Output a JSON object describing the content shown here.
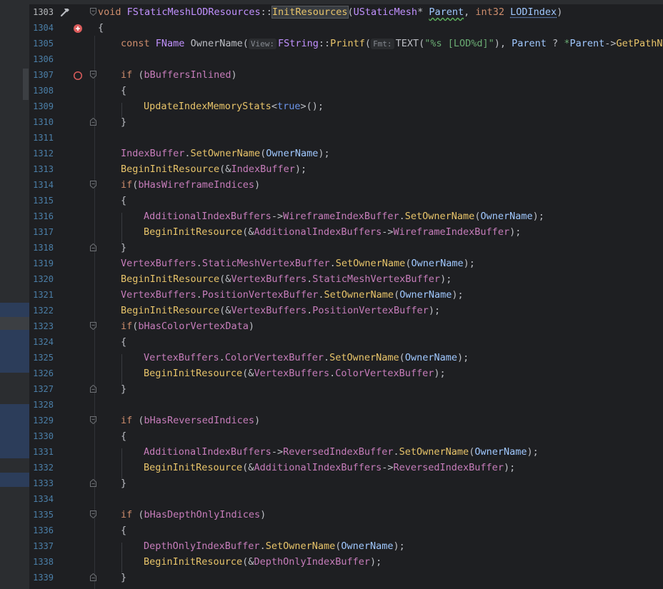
{
  "editor": {
    "lines": [
      {
        "num": "1303",
        "current": true,
        "gutter": "hammer-icon",
        "fold": "open",
        "indent": 0,
        "tokens": [
          [
            "t-kw",
            "void "
          ],
          [
            "t-cls",
            "FStaticMeshLODResources"
          ],
          [
            "t-punc",
            "::"
          ],
          [
            "t-call sel",
            "InitResources"
          ],
          [
            "t-punc",
            "("
          ],
          [
            "t-cls",
            "UStaticMesh"
          ],
          [
            "t-punc",
            "* "
          ],
          [
            "t-par squig",
            "Parent"
          ],
          [
            "t-punc",
            ", "
          ],
          [
            "t-kw",
            "int32 "
          ],
          [
            "t-par squig2",
            "LODIndex"
          ],
          [
            "t-punc",
            ")"
          ]
        ]
      },
      {
        "num": "1304",
        "gutter": "breakpoint-add-icon",
        "fold": "",
        "indent": 0,
        "tokens": [
          [
            "t-punc",
            "{"
          ]
        ]
      },
      {
        "num": "1305",
        "gutter": "",
        "fold": "",
        "indent": 1,
        "tokens": [
          [
            "t-kw",
            "const "
          ],
          [
            "t-cls",
            "FName "
          ],
          [
            "t-var",
            "OwnerName("
          ],
          [
            "hint",
            "View:"
          ],
          [
            "t-cls",
            "FString"
          ],
          [
            "t-punc",
            "::"
          ],
          [
            "t-call",
            "Printf"
          ],
          [
            "t-punc",
            "("
          ],
          [
            "hint",
            "Fmt:"
          ],
          [
            "t-mac",
            "TEXT("
          ],
          [
            "t-str",
            "\"%s [LOD%d]\""
          ],
          [
            "t-punc",
            "), "
          ],
          [
            "t-par",
            "Parent"
          ],
          [
            "t-punc",
            " ? "
          ],
          [
            "t-str",
            "*"
          ],
          [
            "t-par",
            "Parent"
          ],
          [
            "t-punc",
            "->"
          ],
          [
            "t-call",
            "GetPathName"
          ]
        ]
      },
      {
        "num": "1306",
        "gutter": "",
        "fold": "",
        "indent": 0,
        "tokens": []
      },
      {
        "num": "1307",
        "gutter": "breakpoint-icon",
        "fold": "open",
        "indent": 1,
        "tokens": [
          [
            "t-kw",
            "if "
          ],
          [
            "t-punc",
            "("
          ],
          [
            "t-mem",
            "bBuffersInlined"
          ],
          [
            "t-punc",
            ")"
          ]
        ]
      },
      {
        "num": "1308",
        "gutter": "",
        "fold": "",
        "indent": 1,
        "tokens": [
          [
            "t-punc",
            "{"
          ]
        ]
      },
      {
        "num": "1309",
        "gutter": "",
        "fold": "",
        "indent": 2,
        "tokens": [
          [
            "t-call",
            "UpdateIndexMemoryStats"
          ],
          [
            "t-punc",
            "<"
          ],
          [
            "t-kw2",
            "true"
          ],
          [
            "t-punc",
            ">();"
          ]
        ]
      },
      {
        "num": "1310",
        "gutter": "",
        "fold": "close",
        "indent": 1,
        "tokens": [
          [
            "t-punc",
            "}"
          ]
        ]
      },
      {
        "num": "1311",
        "gutter": "",
        "fold": "",
        "indent": 0,
        "tokens": []
      },
      {
        "num": "1312",
        "gutter": "",
        "fold": "",
        "indent": 1,
        "tokens": [
          [
            "t-mem",
            "IndexBuffer"
          ],
          [
            "t-punc",
            "."
          ],
          [
            "t-call",
            "SetOwnerName"
          ],
          [
            "t-punc",
            "("
          ],
          [
            "t-par",
            "OwnerName"
          ],
          [
            "t-punc",
            ");"
          ]
        ]
      },
      {
        "num": "1313",
        "gutter": "",
        "fold": "",
        "indent": 1,
        "tokens": [
          [
            "t-call",
            "BeginInitResource"
          ],
          [
            "t-punc",
            "(&"
          ],
          [
            "t-mem",
            "IndexBuffer"
          ],
          [
            "t-punc",
            ");"
          ]
        ]
      },
      {
        "num": "1314",
        "gutter": "",
        "fold": "open",
        "indent": 1,
        "tokens": [
          [
            "t-kw",
            "if"
          ],
          [
            "t-punc",
            "("
          ],
          [
            "t-mem",
            "bHasWireframeIndices"
          ],
          [
            "t-punc",
            ")"
          ]
        ]
      },
      {
        "num": "1315",
        "gutter": "",
        "fold": "",
        "indent": 1,
        "tokens": [
          [
            "t-punc",
            "{"
          ]
        ]
      },
      {
        "num": "1316",
        "gutter": "",
        "fold": "",
        "indent": 2,
        "tokens": [
          [
            "t-mem",
            "AdditionalIndexBuffers"
          ],
          [
            "t-punc",
            "->"
          ],
          [
            "t-mem",
            "WireframeIndexBuffer"
          ],
          [
            "t-punc",
            "."
          ],
          [
            "t-call",
            "SetOwnerName"
          ],
          [
            "t-punc",
            "("
          ],
          [
            "t-par",
            "OwnerName"
          ],
          [
            "t-punc",
            ");"
          ]
        ]
      },
      {
        "num": "1317",
        "gutter": "",
        "fold": "",
        "indent": 2,
        "tokens": [
          [
            "t-call",
            "BeginInitResource"
          ],
          [
            "t-punc",
            "(&"
          ],
          [
            "t-mem",
            "AdditionalIndexBuffers"
          ],
          [
            "t-punc",
            "->"
          ],
          [
            "t-mem",
            "WireframeIndexBuffer"
          ],
          [
            "t-punc",
            ");"
          ]
        ]
      },
      {
        "num": "1318",
        "gutter": "",
        "fold": "close",
        "indent": 1,
        "tokens": [
          [
            "t-punc",
            "}"
          ]
        ]
      },
      {
        "num": "1319",
        "gutter": "",
        "fold": "",
        "indent": 1,
        "tokens": [
          [
            "t-mem",
            "VertexBuffers"
          ],
          [
            "t-punc",
            "."
          ],
          [
            "t-mem",
            "StaticMeshVertexBuffer"
          ],
          [
            "t-punc",
            "."
          ],
          [
            "t-call",
            "SetOwnerName"
          ],
          [
            "t-punc",
            "("
          ],
          [
            "t-par",
            "OwnerName"
          ],
          [
            "t-punc",
            ");"
          ]
        ]
      },
      {
        "num": "1320",
        "gutter": "",
        "fold": "",
        "indent": 1,
        "tokens": [
          [
            "t-call",
            "BeginInitResource"
          ],
          [
            "t-punc",
            "(&"
          ],
          [
            "t-mem",
            "VertexBuffers"
          ],
          [
            "t-punc",
            "."
          ],
          [
            "t-mem",
            "StaticMeshVertexBuffer"
          ],
          [
            "t-punc",
            ");"
          ]
        ]
      },
      {
        "num": "1321",
        "gutter": "",
        "fold": "",
        "indent": 1,
        "tokens": [
          [
            "t-mem",
            "VertexBuffers"
          ],
          [
            "t-punc",
            "."
          ],
          [
            "t-mem",
            "PositionVertexBuffer"
          ],
          [
            "t-punc",
            "."
          ],
          [
            "t-call",
            "SetOwnerName"
          ],
          [
            "t-punc",
            "("
          ],
          [
            "t-par",
            "OwnerName"
          ],
          [
            "t-punc",
            ");"
          ]
        ]
      },
      {
        "num": "1322",
        "gutter": "",
        "fold": "",
        "indent": 1,
        "tokens": [
          [
            "t-call",
            "BeginInitResource"
          ],
          [
            "t-punc",
            "(&"
          ],
          [
            "t-mem",
            "VertexBuffers"
          ],
          [
            "t-punc",
            "."
          ],
          [
            "t-mem",
            "PositionVertexBuffer"
          ],
          [
            "t-punc",
            ");"
          ]
        ]
      },
      {
        "num": "1323",
        "gutter": "",
        "fold": "open",
        "indent": 1,
        "tokens": [
          [
            "t-kw",
            "if"
          ],
          [
            "t-punc",
            "("
          ],
          [
            "t-mem",
            "bHasColorVertexData"
          ],
          [
            "t-punc",
            ")"
          ]
        ]
      },
      {
        "num": "1324",
        "gutter": "",
        "fold": "",
        "indent": 1,
        "tokens": [
          [
            "t-punc",
            "{"
          ]
        ]
      },
      {
        "num": "1325",
        "gutter": "",
        "fold": "",
        "indent": 2,
        "tokens": [
          [
            "t-mem",
            "VertexBuffers"
          ],
          [
            "t-punc",
            "."
          ],
          [
            "t-mem",
            "ColorVertexBuffer"
          ],
          [
            "t-punc",
            "."
          ],
          [
            "t-call",
            "SetOwnerName"
          ],
          [
            "t-punc",
            "("
          ],
          [
            "t-par",
            "OwnerName"
          ],
          [
            "t-punc",
            ");"
          ]
        ]
      },
      {
        "num": "1326",
        "gutter": "",
        "fold": "",
        "indent": 2,
        "tokens": [
          [
            "t-call",
            "BeginInitResource"
          ],
          [
            "t-punc",
            "(&"
          ],
          [
            "t-mem",
            "VertexBuffers"
          ],
          [
            "t-punc",
            "."
          ],
          [
            "t-mem",
            "ColorVertexBuffer"
          ],
          [
            "t-punc",
            ");"
          ]
        ]
      },
      {
        "num": "1327",
        "gutter": "",
        "fold": "close",
        "indent": 1,
        "tokens": [
          [
            "t-punc",
            "}"
          ]
        ]
      },
      {
        "num": "1328",
        "gutter": "",
        "fold": "",
        "indent": 0,
        "tokens": []
      },
      {
        "num": "1329",
        "gutter": "",
        "fold": "open",
        "indent": 1,
        "tokens": [
          [
            "t-kw",
            "if "
          ],
          [
            "t-punc",
            "("
          ],
          [
            "t-mem",
            "bHasReversedIndices"
          ],
          [
            "t-punc",
            ")"
          ]
        ]
      },
      {
        "num": "1330",
        "gutter": "",
        "fold": "",
        "indent": 1,
        "tokens": [
          [
            "t-punc",
            "{"
          ]
        ]
      },
      {
        "num": "1331",
        "gutter": "",
        "fold": "",
        "indent": 2,
        "tokens": [
          [
            "t-mem",
            "AdditionalIndexBuffers"
          ],
          [
            "t-punc",
            "->"
          ],
          [
            "t-mem",
            "ReversedIndexBuffer"
          ],
          [
            "t-punc",
            "."
          ],
          [
            "t-call",
            "SetOwnerName"
          ],
          [
            "t-punc",
            "("
          ],
          [
            "t-par",
            "OwnerName"
          ],
          [
            "t-punc",
            ");"
          ]
        ]
      },
      {
        "num": "1332",
        "gutter": "",
        "fold": "",
        "indent": 2,
        "tokens": [
          [
            "t-call",
            "BeginInitResource"
          ],
          [
            "t-punc",
            "(&"
          ],
          [
            "t-mem",
            "AdditionalIndexBuffers"
          ],
          [
            "t-punc",
            "->"
          ],
          [
            "t-mem",
            "ReversedIndexBuffer"
          ],
          [
            "t-punc",
            ");"
          ]
        ]
      },
      {
        "num": "1333",
        "gutter": "",
        "fold": "close",
        "indent": 1,
        "tokens": [
          [
            "t-punc",
            "}"
          ]
        ]
      },
      {
        "num": "1334",
        "gutter": "",
        "fold": "",
        "indent": 0,
        "tokens": []
      },
      {
        "num": "1335",
        "gutter": "",
        "fold": "open",
        "indent": 1,
        "tokens": [
          [
            "t-kw",
            "if "
          ],
          [
            "t-punc",
            "("
          ],
          [
            "t-mem",
            "bHasDepthOnlyIndices"
          ],
          [
            "t-punc",
            ")"
          ]
        ]
      },
      {
        "num": "1336",
        "gutter": "",
        "fold": "",
        "indent": 1,
        "tokens": [
          [
            "t-punc",
            "{"
          ]
        ]
      },
      {
        "num": "1337",
        "gutter": "",
        "fold": "",
        "indent": 2,
        "tokens": [
          [
            "t-mem",
            "DepthOnlyIndexBuffer"
          ],
          [
            "t-punc",
            "."
          ],
          [
            "t-call",
            "SetOwnerName"
          ],
          [
            "t-punc",
            "("
          ],
          [
            "t-par",
            "OwnerName"
          ],
          [
            "t-punc",
            ");"
          ]
        ]
      },
      {
        "num": "1338",
        "gutter": "",
        "fold": "",
        "indent": 2,
        "tokens": [
          [
            "t-call",
            "BeginInitResource"
          ],
          [
            "t-punc",
            "(&"
          ],
          [
            "t-mem",
            "DepthOnlyIndexBuffer"
          ],
          [
            "t-punc",
            ");"
          ]
        ]
      },
      {
        "num": "1339",
        "gutter": "",
        "fold": "close",
        "indent": 1,
        "tokens": [
          [
            "t-punc",
            "}"
          ]
        ]
      }
    ]
  },
  "colors": {
    "background": "#1e1f22",
    "gutter_strip": "#2b2d30",
    "strip_highlight": "#2c3d5a",
    "strip_gray": "#3c3f43",
    "breakpoint": "#db5c5c"
  }
}
